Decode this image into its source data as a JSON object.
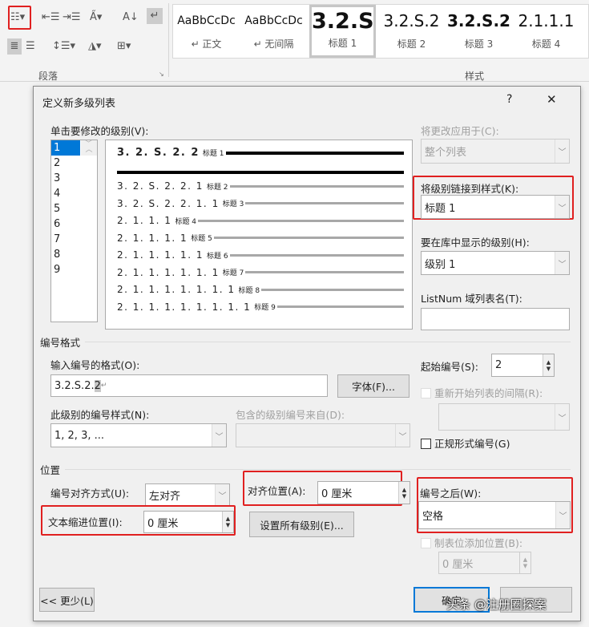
{
  "ribbon": {
    "group_paragraph": "段落",
    "group_styles": "样式",
    "styles": [
      {
        "preview": "AaBbCcDc",
        "name": "↵ 正文"
      },
      {
        "preview": "AaBbCcDc",
        "name": "↵ 无间隔"
      },
      {
        "preview": "3.2.S",
        "name": "标题 1"
      },
      {
        "preview": "3.2.S.2",
        "name": "标题 2"
      },
      {
        "preview": "3.2.S.2",
        "name": "标题 3"
      },
      {
        "preview": "2.1.1.1",
        "name": "标题 4"
      }
    ]
  },
  "dialog": {
    "title": "定义新多级列表",
    "help": "?",
    "close": "✕",
    "level_label": "单击要修改的级别(V):",
    "levels": [
      "1",
      "2",
      "3",
      "4",
      "5",
      "6",
      "7",
      "8",
      "9"
    ],
    "preview": [
      {
        "num": "3. 2. S. 2. 2",
        "style": "标题 1"
      },
      {
        "num": "3. 2. S. 2. 2. 1",
        "style": "标题 2"
      },
      {
        "num": "3. 2. S. 2. 2. 1. 1",
        "style": "标题 3"
      },
      {
        "num": "2. 1. 1. 1",
        "style": "标题 4"
      },
      {
        "num": "2. 1. 1. 1. 1",
        "style": "标题 5"
      },
      {
        "num": "2. 1. 1. 1. 1. 1",
        "style": "标题 6"
      },
      {
        "num": "2. 1. 1. 1. 1. 1. 1",
        "style": "标题 7"
      },
      {
        "num": "2. 1. 1. 1. 1. 1. 1. 1",
        "style": "标题 8"
      },
      {
        "num": "2. 1. 1. 1. 1. 1. 1. 1. 1",
        "style": "标题 9"
      }
    ],
    "apply_to_label": "将更改应用于(C):",
    "apply_to_value": "整个列表",
    "link_style_label": "将级别链接到样式(K):",
    "link_style_value": "标题 1",
    "gallery_level_label": "要在库中显示的级别(H):",
    "gallery_level_value": "级别 1",
    "listnum_label": "ListNum 域列表名(T):",
    "listnum_value": "",
    "number_format_section": "编号格式",
    "format_label": "输入编号的格式(O):",
    "format_value": "3.2.S.2.",
    "format_highlight": "2",
    "format_mark": "↵",
    "font_button": "字体(F)...",
    "start_label": "起始编号(S):",
    "start_value": "2",
    "restart_label": "重新开始列表的间隔(R):",
    "style_label": "此级别的编号样式(N):",
    "style_value": "1, 2, 3, ...",
    "include_label": "包含的级别编号来自(D):",
    "legal_label": "正规形式编号(G)",
    "position_section": "位置",
    "align_label": "编号对齐方式(U):",
    "align_value": "左对齐",
    "align_at_label": "对齐位置(A):",
    "align_at_value": "0 厘米",
    "follow_label": "编号之后(W):",
    "follow_value": "空格",
    "indent_label": "文本缩进位置(I):",
    "indent_value": "0 厘米",
    "set_all_button": "设置所有级别(E)...",
    "tab_label": "制表位添加位置(B):",
    "tab_value": "0 厘米",
    "less_button": "<< 更少(L)",
    "ok_button": "确定"
  },
  "watermark": "头条 @注册圈探案"
}
